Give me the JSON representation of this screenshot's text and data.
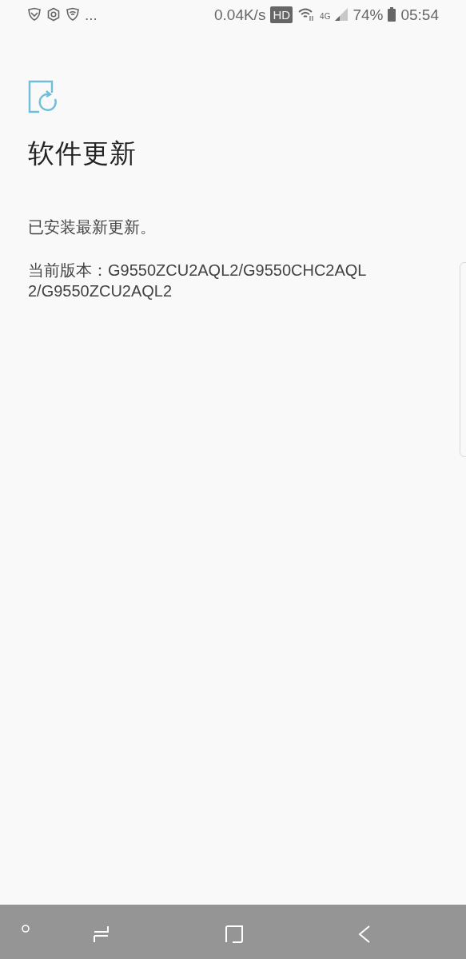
{
  "status_bar": {
    "left_more": "...",
    "speed": "0.04K/s",
    "hd": "HD",
    "network": "4G",
    "battery": "74%",
    "time": "05:54"
  },
  "page": {
    "title": "软件更新",
    "message": "已安装最新更新。",
    "version": "当前版本：G9550ZCU2AQL2/G9550CHC2AQL2/G9550ZCU2AQL2"
  },
  "nav_bar": {
    "kind": "buttons"
  }
}
